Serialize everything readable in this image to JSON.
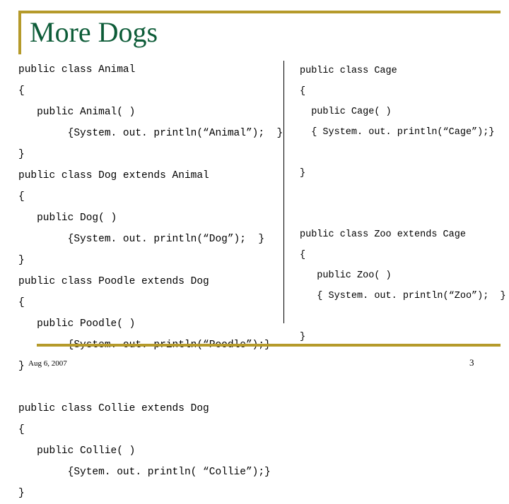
{
  "slide": {
    "title": "More Dogs",
    "accent_color": "#b59a2a",
    "title_color": "#0d5c38",
    "divider_color": "#000000"
  },
  "code_left": "public class Animal\n{\n   public Animal( )\n        {System. out. println(“Animal”);  }\n}\npublic class Dog extends Animal\n{\n   public Dog( )\n        {System. out. println(“Dog”);  }\n}\npublic class Poodle extends Dog\n{\n   public Poodle( )\n        {System. out. println(“Poodle”);}\n}\n\npublic class Collie extends Dog\n{\n   public Collie( )\n        {Sytem. out. println( “Collie”);}\n}",
  "code_right": "public class Cage\n{\n  public Cage( )\n  { System. out. println(“Cage”);}\n\n}\n\n\npublic class Zoo extends Cage\n{\n   public Zoo( )\n   { System. out. println(“Zoo”);  }\n\n}",
  "footer": {
    "date": "Aug 6, 2007",
    "page_number": "3"
  }
}
